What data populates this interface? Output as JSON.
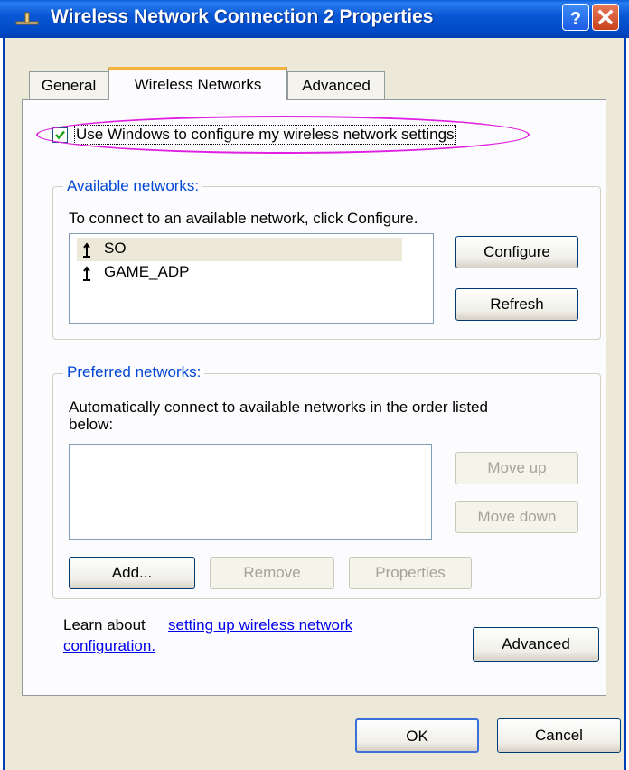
{
  "window": {
    "title": "Wireless Network Connection 2 Properties",
    "icon": "network-connection-icon",
    "help_icon": "help-question-icon",
    "close_icon": "close-x-icon"
  },
  "tabs": [
    {
      "label": "General",
      "active": false
    },
    {
      "label": "Wireless Networks",
      "active": true
    },
    {
      "label": "Advanced",
      "active": false
    }
  ],
  "use_windows_checkbox": {
    "label": "Use Windows to configure my wireless network settings",
    "checked": true
  },
  "available": {
    "legend": "Available networks:",
    "instructions": "To connect to an available network, click Configure.",
    "networks": [
      {
        "name": "SO",
        "selected": true,
        "icon": "antenna-icon"
      },
      {
        "name": "GAME_ADP",
        "selected": false,
        "icon": "antenna-icon"
      }
    ],
    "configure_label": "Configure",
    "refresh_label": "Refresh"
  },
  "preferred": {
    "legend": "Preferred networks:",
    "instructions_line1": "Automatically connect to available networks in the order listed",
    "instructions_line2": "below:",
    "move_up_label": "Move up",
    "move_down_label": "Move down",
    "add_label": "Add...",
    "remove_label": "Remove",
    "properties_label": "Properties"
  },
  "learn": {
    "prefix": "Learn about",
    "link_line1": "setting up wireless network",
    "link_line2": "configuration."
  },
  "advanced_button_label": "Advanced",
  "ok_label": "OK",
  "cancel_label": "Cancel",
  "colors": {
    "titlebar": "#0a58d6",
    "highlight_ellipse": "#e020e0",
    "legend_text": "#0046d5",
    "tab_accent": "#f3b33e"
  }
}
